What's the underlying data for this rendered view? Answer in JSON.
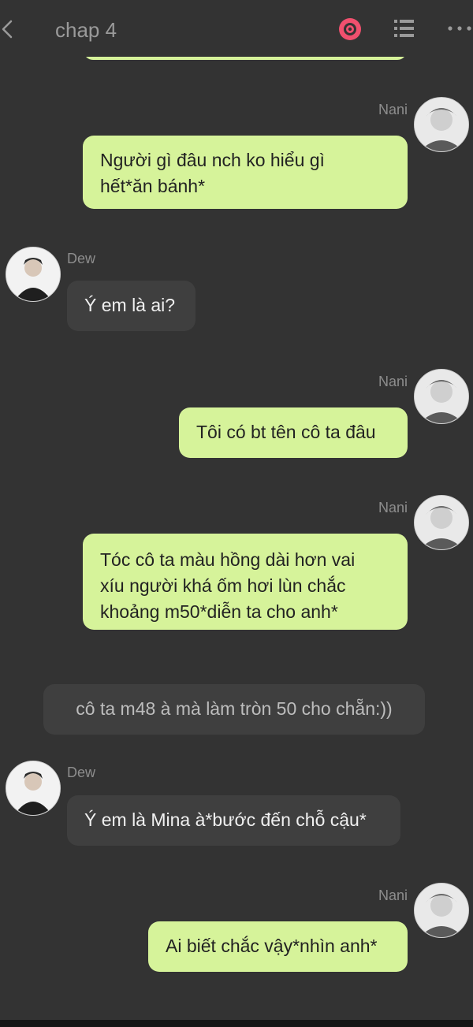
{
  "header": {
    "title": "chap 4",
    "icons": [
      "back-icon",
      "record-icon",
      "list-icon",
      "more-icon"
    ],
    "accent_color": "#f0506e"
  },
  "colors": {
    "background": "#333333",
    "me_bubble": "#d6f39a",
    "other_bubble": "#3f3f3f"
  },
  "messages": [
    {
      "sender": "Nani",
      "side": "right",
      "text": "Người gì đâu nch ko hiểu gì\nhết*ăn bánh*"
    },
    {
      "sender": "Dew",
      "side": "left",
      "text": "Ý em là ai?"
    },
    {
      "sender": "Nani",
      "side": "right",
      "text": "Tôi có bt tên cô ta đâu"
    },
    {
      "sender": "Nani",
      "side": "right",
      "text": "Tóc cô ta màu hồng dài hơn vai\nxíu người khá ốm hơi lùn chắc\nkhoảng m50*diễn ta cho anh*"
    },
    {
      "sender": "",
      "side": "center",
      "text": "cô ta m48 à mà làm tròn 50 cho chẵn:))"
    },
    {
      "sender": "Dew",
      "side": "left",
      "text": "Ý em là Mina à*bước đến chỗ cậu*"
    },
    {
      "sender": "Nani",
      "side": "right",
      "text": "Ai biết chắc vậy*nhìn anh*"
    }
  ]
}
